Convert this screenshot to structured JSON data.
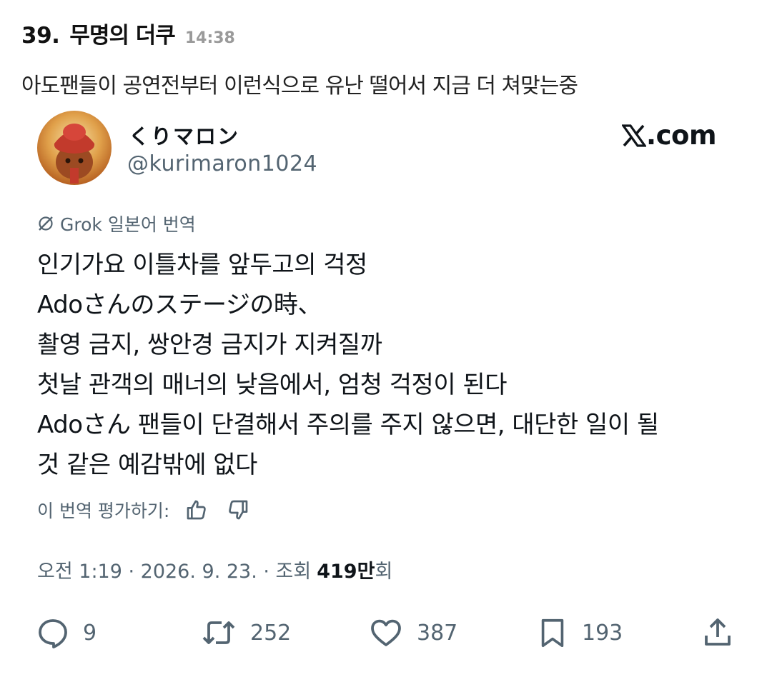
{
  "post": {
    "number": "39.",
    "author": "무명의 더쿠",
    "time": "14:38",
    "body": "아도팬들이 공연전부터 이런식으로 유난 떨어서 지금 더 쳐맞는중"
  },
  "tweet": {
    "display_name": "くりマロン",
    "handle": "@kurimaron1024",
    "source_label": ".com",
    "translation_label": "Grok 일본어 번역",
    "lines": [
      "인기가요 이틀차를 앞두고의 걱정",
      "Adoさんのステージの時、",
      "촬영 금지, 쌍안경 금지가 지켜질까",
      "첫날 관객의 매너의 낮음에서, 엄청 걱정이 된다",
      "Adoさん 팬들이 단결해서 주의를 주지 않으면, 대단한 일이 될",
      "것 같은 예감밖에 없다"
    ],
    "rate_label": "이 번역 평가하기:",
    "meta_datetime": "오전 1:19 · 2026. 9. 23. · 조회",
    "views_count": "419만",
    "views_suffix": "회",
    "replies": "9",
    "retweets": "252",
    "likes": "387",
    "bookmarks": "193"
  },
  "icons": {
    "avatar": "avatar-image",
    "x_logo": "x-logo-icon",
    "grok": "grok-icon",
    "thumbs_up": "thumbs-up-icon",
    "thumbs_down": "thumbs-down-icon",
    "reply": "reply-icon",
    "retweet": "retweet-icon",
    "like": "heart-icon",
    "bookmark": "bookmark-icon",
    "share": "share-icon"
  },
  "colors": {
    "text_primary": "#0f1419",
    "text_secondary": "#536471",
    "post_time": "#9a9a9a"
  }
}
